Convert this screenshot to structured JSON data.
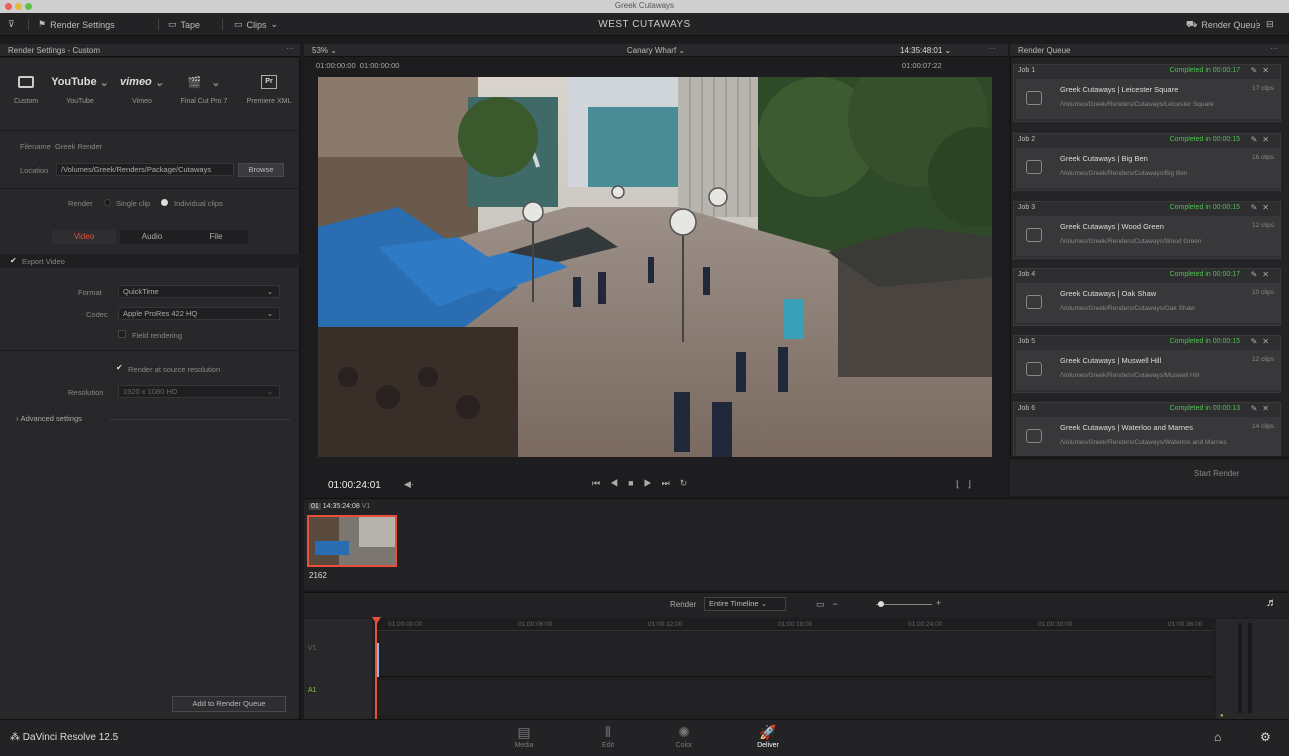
{
  "window": {
    "title": "Greek Cutaways"
  },
  "toolbar": {
    "render_settings": "Render Settings",
    "tape": "Tape",
    "clips": "Clips",
    "project_title": "WEST CUTAWAYS",
    "render_queue": "Render Queue"
  },
  "render_settings": {
    "header": "Render Settings - Custom",
    "presets": [
      {
        "icon": "film-icon",
        "label": "Custom"
      },
      {
        "icon": "youtube-icon",
        "label": "YouTube",
        "brand": "YouTube"
      },
      {
        "icon": "vimeo-icon",
        "label": "Vimeo",
        "brand": "vimeo"
      },
      {
        "icon": "clapper-icon",
        "label": "Final Cut Pro 7"
      },
      {
        "icon": "premiere-icon",
        "label": "Premiere XML"
      }
    ],
    "filename_label": "Filename",
    "filename_value": "Greek Render",
    "location_label": "Location",
    "location_value": "/Volumes/Greek/Renders/Package/Cutaways",
    "browse": "Browse",
    "render_label": "Render",
    "single_clip": "Single clip",
    "individual_clips": "Individual clips",
    "tabs": [
      "Video",
      "Audio",
      "File"
    ],
    "export_video": "Export Video",
    "format_label": "Format",
    "format_value": "QuickTime",
    "codec_label": "Codec",
    "codec_value": "Apple ProRes 422 HQ",
    "field_rendering": "Field rendering",
    "render_source_resolution": "Render at source resolution",
    "resolution_label": "Resolution",
    "resolution_value": "1920 x 1080 HD",
    "advanced_settings": "Advanced settings",
    "add_to_queue": "Add to Render Queue"
  },
  "viewer": {
    "zoom": "53%",
    "timeline_name": "Canary Wharf",
    "timecode_top": "14:35:48:01",
    "tc_left": "01:00:00:00",
    "tc_left2": "01:00:00:00",
    "tc_right": "01:00:07:22",
    "current_timecode": "01:00:24:01"
  },
  "render_queue": {
    "header": "Render Queue",
    "jobs": [
      {
        "id": "Job 1",
        "status": "Completed in 00:00:17",
        "title": "Greek Cutaways | Leicester Square",
        "path": "/Volumes/Greek/Renders/Cutaways/Leicester Square",
        "frames": "17 clips"
      },
      {
        "id": "Job 2",
        "status": "Completed in 00:00:15",
        "title": "Greek Cutaways | Big Ben",
        "path": "/Volumes/Greek/Renders/Cutaways/Big Ben",
        "frames": "16 clips"
      },
      {
        "id": "Job 3",
        "status": "Completed in 00:00:15",
        "title": "Greek Cutaways | Wood Green",
        "path": "/Volumes/Greek/Renders/Cutaways/Wood Green",
        "frames": "12 clips"
      },
      {
        "id": "Job 4",
        "status": "Completed in 00:00:17",
        "title": "Greek Cutaways | Oak Shaw",
        "path": "/Volumes/Greek/Renders/Cutaways/Oak Shaw",
        "frames": "10 clips"
      },
      {
        "id": "Job 5",
        "status": "Completed in 00:00:15",
        "title": "Greek Cutaways | Muswell Hill",
        "path": "/Volumes/Greek/Renders/Cutaways/Muswell Hill",
        "frames": "12 clips"
      },
      {
        "id": "Job 6",
        "status": "Completed in 00:00:13",
        "title": "Greek Cutaways | Waterloo and Marnes",
        "path": "/Volumes/Greek/Renders/Cutaways/Waterloo and Marnes",
        "frames": "14 clips"
      }
    ],
    "start_render": "Start Render"
  },
  "clips": {
    "clip_index": "01",
    "clip_tc": "14:35:24:08",
    "clip_name": "2162"
  },
  "timeline": {
    "render_label": "Render",
    "render_value": "Entire Timeline",
    "ruler": [
      "01:00:00:00",
      "01:00:06:00",
      "01:00:12:00",
      "01:00:18:00",
      "01:00:24:00",
      "01:00:30:00",
      "01:00:36:00"
    ],
    "track_v": "V1",
    "track_a": "A1"
  },
  "bottom": {
    "app_name": "DaVinci Resolve 12.5",
    "pages": [
      {
        "icon": "media-icon",
        "label": "Media"
      },
      {
        "icon": "edit-icon",
        "label": "Edit"
      },
      {
        "icon": "color-icon",
        "label": "Color"
      },
      {
        "icon": "deliver-icon",
        "label": "Deliver"
      }
    ]
  },
  "colors": {
    "accent": "#e8503a",
    "completed": "#4ec04e",
    "deliver_active": "#ffffff"
  }
}
